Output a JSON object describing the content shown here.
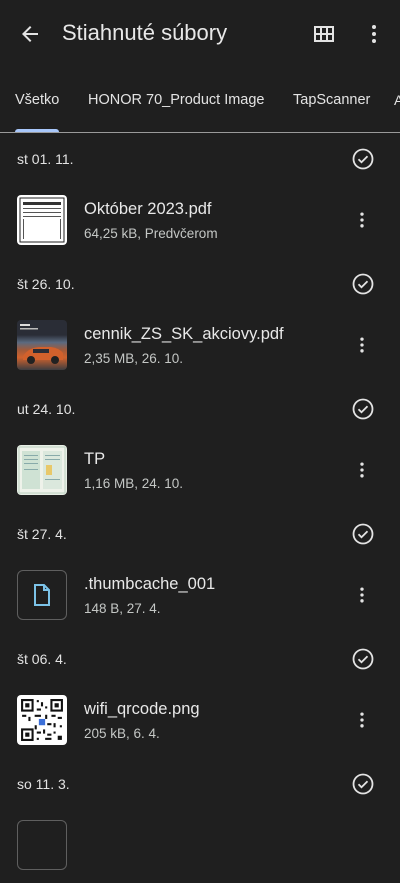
{
  "header": {
    "title": "Stiahnuté súbory",
    "back_icon": "arrow-back-icon",
    "grid_icon": "grid-view-icon",
    "more_icon": "more-vert-icon"
  },
  "tabs": [
    {
      "label": "Všetko",
      "active": true
    },
    {
      "label": "HONOR 70_Product Image",
      "active": false
    },
    {
      "label": "TapScanner",
      "active": false
    }
  ],
  "groups": [
    {
      "date": "st 01. 11.",
      "files": [
        {
          "name": "Október 2023.pdf",
          "meta": "64,25 kB, Predvčerom",
          "thumb": "pdf-document"
        }
      ]
    },
    {
      "date": "št 26. 10.",
      "files": [
        {
          "name": "cennik_ZS_SK_akciovy.pdf",
          "meta": "2,35 MB, 26. 10.",
          "thumb": "car-brochure"
        }
      ]
    },
    {
      "date": "ut 24. 10.",
      "files": [
        {
          "name": "TP",
          "meta": "1,16 MB, 24. 10.",
          "thumb": "scanned-document"
        }
      ]
    },
    {
      "date": "št 27. 4.",
      "files": [
        {
          "name": ".thumbcache_001",
          "meta": "148 B, 27. 4.",
          "thumb": "file-icon"
        }
      ]
    },
    {
      "date": "št 06. 4.",
      "files": [
        {
          "name": "wifi_qrcode.png",
          "meta": "205 kB, 6. 4.",
          "thumb": "qr-code"
        }
      ]
    },
    {
      "date": "so 11. 3.",
      "files": []
    }
  ],
  "colors": {
    "background": "#1f1f1f",
    "accent": "#a8c7fa",
    "file_icon": "#7cc3e8"
  }
}
